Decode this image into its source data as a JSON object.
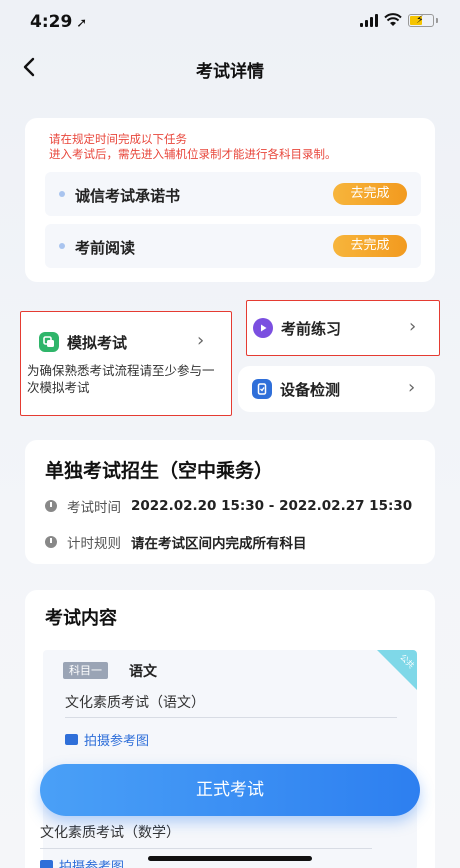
{
  "status_bar": {
    "time": "4:29",
    "location_arrow": "➚"
  },
  "nav": {
    "title": "考试详情",
    "back_icon": "chevron-left-icon"
  },
  "tasks": {
    "notice_line1": "请在规定时间完成以下任务",
    "notice_line2": "进入考试后，需先进入辅机位录制才能进行各科目录制。",
    "items": [
      {
        "label": "诚信考试承诺书",
        "action": "去完成"
      },
      {
        "label": "考前阅读",
        "action": "去完成"
      }
    ]
  },
  "entries": {
    "mock": {
      "title": "模拟考试",
      "desc": "为确保熟悉考试流程请至少参与一次模拟考试",
      "icon_color": "#2fb56a"
    },
    "practice": {
      "title": "考前练习",
      "icon_color": "#7b4fe0"
    },
    "device": {
      "title": "设备检测",
      "icon_color": "#2f6fd9"
    }
  },
  "exam": {
    "title": "单独考试招生（空中乘务）",
    "time_label": "考试时间",
    "time_value": "2022.02.20 15:30 - 2022.02.27 15:30",
    "rule_label": "计时规则",
    "rule_value": "请在考试区间内完成所有科目"
  },
  "content": {
    "title": "考试内容",
    "subjects": [
      {
        "badge": "科目一",
        "name": "语文",
        "desc": "文化素质考试（语文）",
        "photo_label": "拍摄参考图",
        "corner": "公共"
      },
      {
        "desc": "文化素质考试（数学）",
        "photo_label": "拍摄参考图"
      }
    ]
  },
  "start_button": "正式考试",
  "colors": {
    "accent": "#2d7ff0",
    "warning": "#f29a1f",
    "notice": "#e8473c"
  }
}
